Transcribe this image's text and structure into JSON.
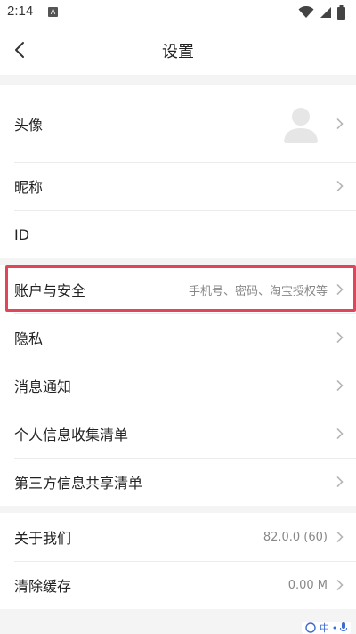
{
  "status_bar": {
    "time": "2:14",
    "notification_letter": "A"
  },
  "nav": {
    "title": "设置"
  },
  "groups": [
    {
      "rows": [
        {
          "label": "头像",
          "value": ""
        },
        {
          "label": "昵称",
          "value": ""
        },
        {
          "label": "ID",
          "value": ""
        }
      ]
    },
    {
      "rows": [
        {
          "label": "账户与安全",
          "value": "手机号、密码、淘宝授权等"
        },
        {
          "label": "隐私",
          "value": ""
        },
        {
          "label": "消息通知",
          "value": ""
        },
        {
          "label": "个人信息收集清单",
          "value": ""
        },
        {
          "label": "第三方信息共享清单",
          "value": ""
        }
      ]
    },
    {
      "rows": [
        {
          "label": "关于我们",
          "value": "82.0.0 (60)"
        },
        {
          "label": "清除缓存",
          "value": "0.00 M"
        }
      ]
    }
  ],
  "ime": {
    "char": "中"
  },
  "colors": {
    "highlight": "#e0455a",
    "chevron": "#b5b5b5",
    "ime": "#3d6bd1"
  }
}
